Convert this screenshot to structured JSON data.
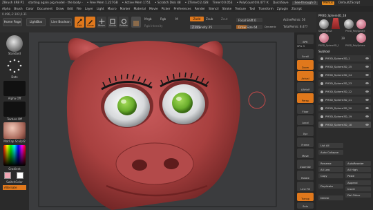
{
  "titlebar": {
    "app": "ZBrush 4R8 P1",
    "document": "starting again pig model - the body -",
    "free_mem": "• Free Mem 1.227GB",
    "active_mem": "• Active Mem 1751",
    "scratch": "• Scratch Disk 48",
    "ztime": "• ZTime©2.428",
    "timer": "Timer©0.053",
    "polycount": "• PolyCount©8.477 K",
    "quicksave": "QuickSave",
    "see_through": "See-through 0",
    "menus": "Menus",
    "default_script": "DefaultZScript"
  },
  "menubar": [
    "Alpha",
    "Brush",
    "Color",
    "Document",
    "Draw",
    "Edit",
    "File",
    "Layer",
    "Light",
    "Macro",
    "Marker",
    "Material",
    "Movie",
    "Picker",
    "Preferences",
    "Render",
    "Stencil",
    "Stroke",
    "Texture",
    "Tool",
    "Transform",
    "Zplugin",
    "Zscript"
  ],
  "coords": "0.496,-2.102,0.31",
  "toolbar": {
    "home_page": "Home Page",
    "lightbox": "LightBox",
    "live_boolean": "Live Boolean",
    "edit": "Edit",
    "draw": "Draw",
    "move": "Move",
    "scale": "Scale",
    "rotate": "Rotate",
    "mrgb": "Mrgb",
    "rgb": "Rgb",
    "m": "M",
    "rgb_intensity": "Rgb Intensity",
    "zadd": "Zadd",
    "zsub": "Zsub",
    "zcut": "Zcut",
    "z_intensity": "Z Intensity 25",
    "focal_shift": "Focal Shift 0",
    "draw_size": "Draw Size 64",
    "dynamic": "Dynamic",
    "active_points": "ActivePoints: 56",
    "total_points": "TotalPoints: 8.477"
  },
  "left_shelf": {
    "brush": "Standard",
    "stroke": "Dots",
    "alpha": "Alpha Off",
    "texture": "Texture Off",
    "material": "MatCap Sculpt2",
    "gradient": "Gradient",
    "switch_color": "SwitchColor",
    "alternate": "Alternate"
  },
  "right_strip": {
    "bpr": "BPR",
    "spix": "SPix 3",
    "scroll": "Scroll",
    "zoom": "Zoom",
    "actual": "Actual",
    "aahalf": "AAHalf",
    "persp": "Persp",
    "floor": "Floor",
    "local": "Local",
    "xyz": "Xyz",
    "frame": "Frame",
    "move": "Move",
    "zoom3d": "Zoom3D",
    "rotate": "Rotate",
    "line_fill": "Line Fill",
    "polyf": "PolyF",
    "transp": "Transp",
    "dynamic": "Dynamic",
    "solo": "Solo"
  },
  "palette": {
    "tool_name": "PM3D_Sphere3D_18",
    "count": "39",
    "thumbs": [
      "SimpleBrush",
      "PM3D_PolySphere",
      "PM3D_Sphere3D_1",
      "PM3D_PolySphere"
    ],
    "subtool_title": "Subtool",
    "subtools": [
      "PM3D_Sphere3D_1",
      "PM3D_Sphere3D_25",
      "PM3D_Sphere3D_24",
      "PM3D_Sphere3D_23",
      "PM3D_Sphere3D_22",
      "PM3D_Sphere3D_21",
      "PM3D_Sphere3D_20",
      "PM3D_Sphere3D_19",
      "PM3D_Sphere3D_18"
    ],
    "list_all": "List All",
    "auto_collapse": "Auto Collapse",
    "rename": "Rename",
    "autoreorder": "AutoReorder",
    "all_low": "All Low",
    "all_high": "All High",
    "copy": "Copy",
    "paste": "Paste",
    "duplicate": "Duplicate",
    "append": "Append",
    "insert": "Insert",
    "delete": "Delete",
    "del_other": "Del Other"
  },
  "colors": {
    "accent": "#e0781c",
    "pig_skin": "#b5484a",
    "iris": "#7ec03a",
    "sclera": "#e9eaeb"
  }
}
